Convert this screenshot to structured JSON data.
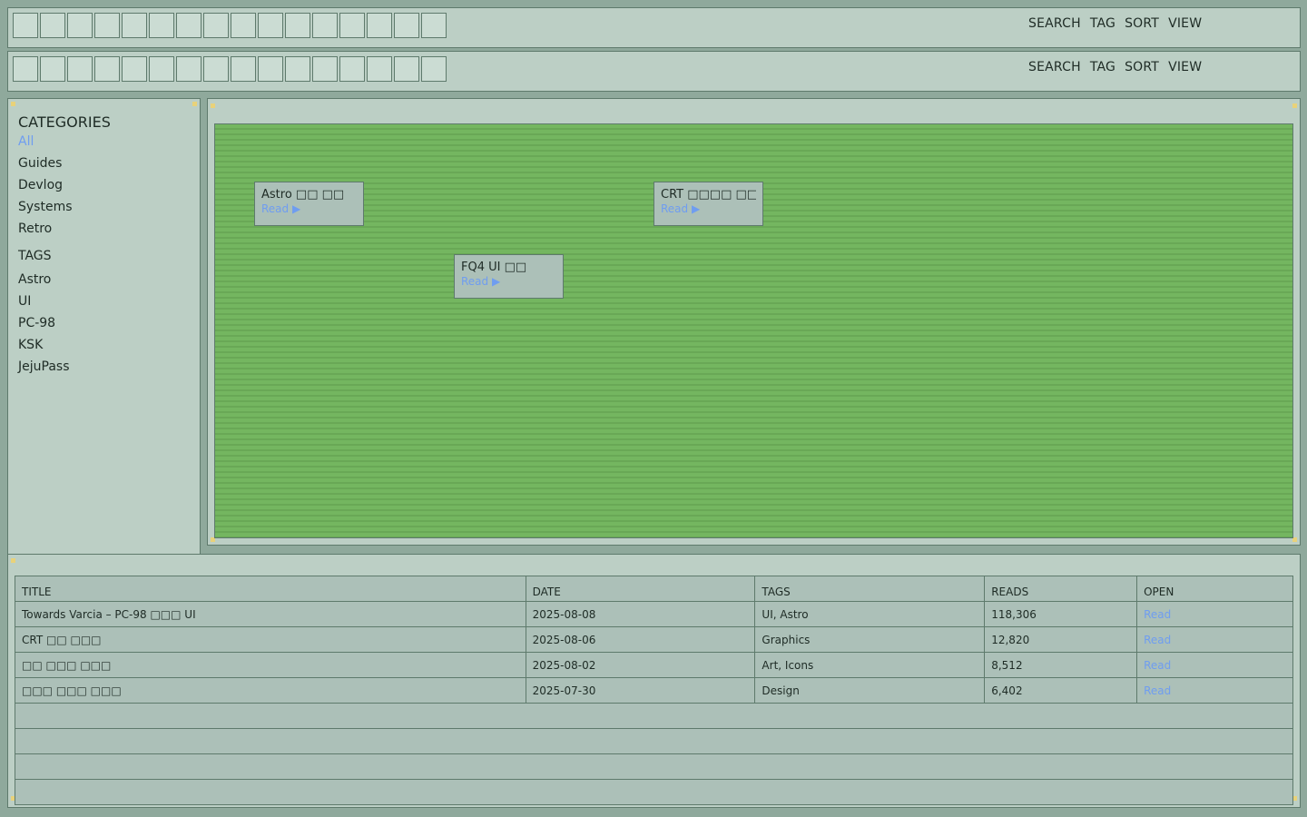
{
  "toolbar_rows": [
    {
      "slot_count": 16,
      "menu": [
        "SEARCH",
        "TAG",
        "SORT",
        "VIEW"
      ]
    },
    {
      "slot_count": 16,
      "menu": [
        "SEARCH",
        "TAG",
        "SORT",
        "VIEW"
      ]
    }
  ],
  "sidebar": {
    "categories_heading": "CATEGORIES",
    "categories": [
      "All",
      "Guides",
      "Devlog",
      "Systems",
      "Retro"
    ],
    "active_category": "All",
    "tags_heading": "TAGS",
    "tags": [
      "Astro",
      "UI",
      "PC-98",
      "KSK",
      "JejuPass"
    ]
  },
  "map": {
    "cards": [
      {
        "title": "Astro □□ □□",
        "link": "Read ▶"
      },
      {
        "title": "FQ4 UI □□",
        "link": "Read ▶"
      },
      {
        "title": "CRT □□□□ □□",
        "link": "Read ▶"
      }
    ]
  },
  "table": {
    "headers": [
      "TITLE",
      "DATE",
      "TAGS",
      "READS",
      "OPEN"
    ],
    "rows": [
      [
        "Towards Varcia – PC-98 □□□ UI",
        "2025-08-08",
        "UI, Astro",
        "118,306",
        "Read"
      ],
      [
        "CRT □□ □□□",
        "2025-08-06",
        "Graphics",
        "12,820",
        "Read"
      ],
      [
        "□□ □□□ □□□",
        "2025-08-02",
        "Art, Icons",
        "8,512",
        "Read"
      ],
      [
        "□□□ □□□ □□□",
        "2025-07-30",
        "Design",
        "6,402",
        "Read"
      ]
    ],
    "empty_rows": 4
  },
  "colors": {
    "background": "#8fa99c",
    "panel": "#bccfc5",
    "link": "#6f9df0",
    "map_green": "#74b660",
    "corner_marker": "#e8d27a"
  }
}
